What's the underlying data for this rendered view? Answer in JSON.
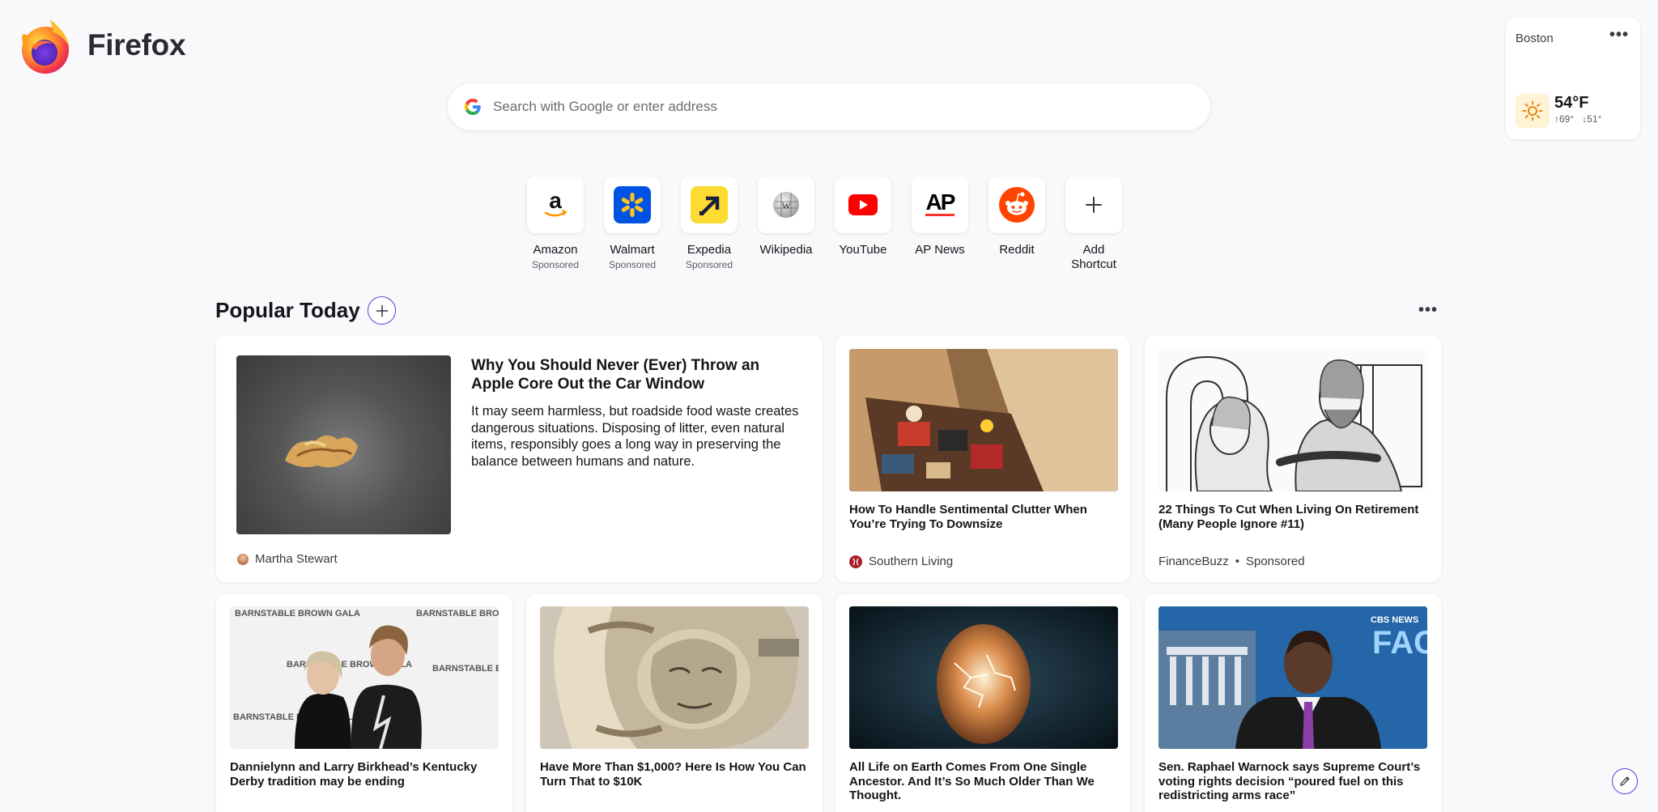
{
  "brand": {
    "name": "Firefox"
  },
  "weather": {
    "city": "Boston",
    "menu": "•••",
    "icon": "sun-icon",
    "temp": "54°F",
    "high": "69°",
    "low": "51°"
  },
  "search": {
    "placeholder": "Search with Google or enter address",
    "icon": "google-icon"
  },
  "shortcuts": [
    {
      "label": "Amazon",
      "sub": "Sponsored"
    },
    {
      "label": "Walmart",
      "sub": "Sponsored"
    },
    {
      "label": "Expedia",
      "sub": "Sponsored"
    },
    {
      "label": "Wikipedia",
      "sub": ""
    },
    {
      "label": "YouTube",
      "sub": ""
    },
    {
      "label": "AP News",
      "sub": ""
    },
    {
      "label": "Reddit",
      "sub": ""
    },
    {
      "label": "Add Shortcut",
      "sub": ""
    }
  ],
  "popular": {
    "title": "Popular Today",
    "menu": "•••",
    "hero": {
      "title": "Why You Should Never (Ever) Throw an Apple Core Out the Car Window",
      "excerpt": "It may seem harmless, but roadside food waste creates dangerous situations. Disposing of litter, even natural items, responsibly goes a long way in preserving the balance between humans and nature.",
      "source": "Martha Stewart"
    },
    "cards": [
      {
        "title": "How To Handle Sentimental Clutter When You’re Trying To Downsize",
        "source": "Southern Living",
        "sponsored": ""
      },
      {
        "title": "22 Things To Cut When Living On Retirement (Many People Ignore #11)",
        "source": "FinanceBuzz",
        "sponsored": "Sponsored"
      },
      {
        "title": "Dannielynn and Larry Birkhead’s Kentucky Derby tradition may be ending"
      },
      {
        "title": "Have More Than $1,000? Here Is How You Can Turn That to $10K"
      },
      {
        "title": "All Life on Earth Comes From One Single Ancestor. And It’s So Much Older Than We Thought."
      },
      {
        "title": "Sen. Raphael Warnock says Supreme Court’s voting rights decision “poured fuel on this redistricting arms race”"
      }
    ]
  },
  "image_text": {
    "gala_banner": "BARNSTABLE BROWN GALA",
    "tv_bug": "CBS NEWS",
    "tv_show": "FACE THE NATION"
  }
}
